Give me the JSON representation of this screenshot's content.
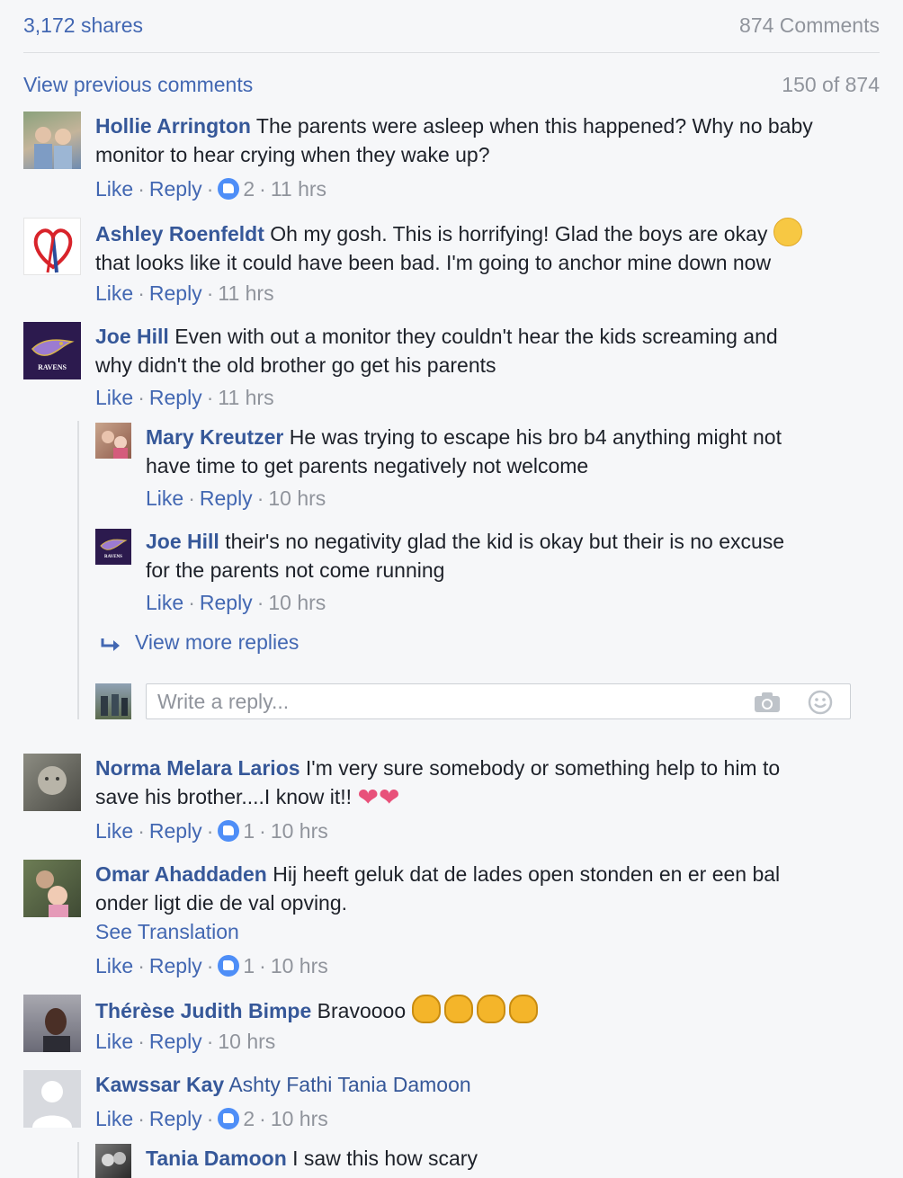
{
  "header": {
    "shares": "3,172 shares",
    "comments_count": "874 Comments"
  },
  "pager": {
    "view_previous": "View previous comments",
    "position": "150 of 874"
  },
  "actions": {
    "like": "Like",
    "reply": "Reply",
    "dot": "·"
  },
  "comments": [
    {
      "name": "Hollie Arrington",
      "text_lines": [
        "The parents were asleep when this happened? Why no baby",
        "monitor to hear crying when they wake up?"
      ],
      "likes": "2",
      "time": "11 hrs"
    },
    {
      "name": "Ashley Roenfeldt",
      "text_lines": [
        "Oh my gosh. This is horrifying! Glad the boys are okay",
        "that looks like it could have been bad. I'm going to anchor mine down now"
      ],
      "time": "11 hrs"
    },
    {
      "name": "Joe Hill",
      "text_lines": [
        "Even with out a monitor they couldn't hear the kids screaming and",
        "why didn't the old brother go get his parents"
      ],
      "time": "11 hrs"
    },
    {
      "name": "Norma Melara Larios",
      "text_lines": [
        "I'm very sure somebody or something help to him to",
        "save his brother....I know it!!"
      ],
      "likes": "1",
      "time": "10 hrs"
    },
    {
      "name": "Omar Ahaddaden",
      "text_lines": [
        "Hij heeft geluk dat de lades open stonden en er een bal",
        "onder ligt die de val opving."
      ],
      "see_translation": "See Translation",
      "likes": "1",
      "time": "10 hrs"
    },
    {
      "name": "Thérèse Judith Bimpe",
      "text_lines": [
        "Bravoooo"
      ],
      "time": "10 hrs"
    },
    {
      "name": "Kawssar Kay",
      "tagged": "Ashty Fathi Tania Damoon",
      "likes": "2",
      "time": "10 hrs"
    }
  ],
  "replies": [
    {
      "name": "Mary Kreutzer",
      "text_lines": [
        "He was trying to escape his bro b4 anything might not",
        "have time to get parents negatively not welcome"
      ],
      "time": "10 hrs"
    },
    {
      "name": "Joe Hill",
      "text_lines": [
        "their's no negativity glad the kid is okay but their is no excuse",
        "for the parents not come running"
      ],
      "time": "10 hrs"
    },
    {
      "name": "Tania Damoon",
      "text_lines": [
        "I saw this how scary"
      ]
    }
  ],
  "view_more_replies": "View more replies",
  "reply_input": {
    "placeholder": "Write a reply..."
  },
  "avatar_badge_text": "RAVENS",
  "colors": {
    "link": "#4267b2",
    "name": "#365899",
    "muted": "#90949c",
    "like_badge": "#4e8ef7",
    "background": "#f6f7f9"
  },
  "icons": [
    "thumbs-up-icon",
    "reply-arrow-icon",
    "camera-icon",
    "smiley-icon",
    "confounded-face-emoji",
    "sparkling-heart-emoji",
    "clapping-hands-emoji"
  ]
}
